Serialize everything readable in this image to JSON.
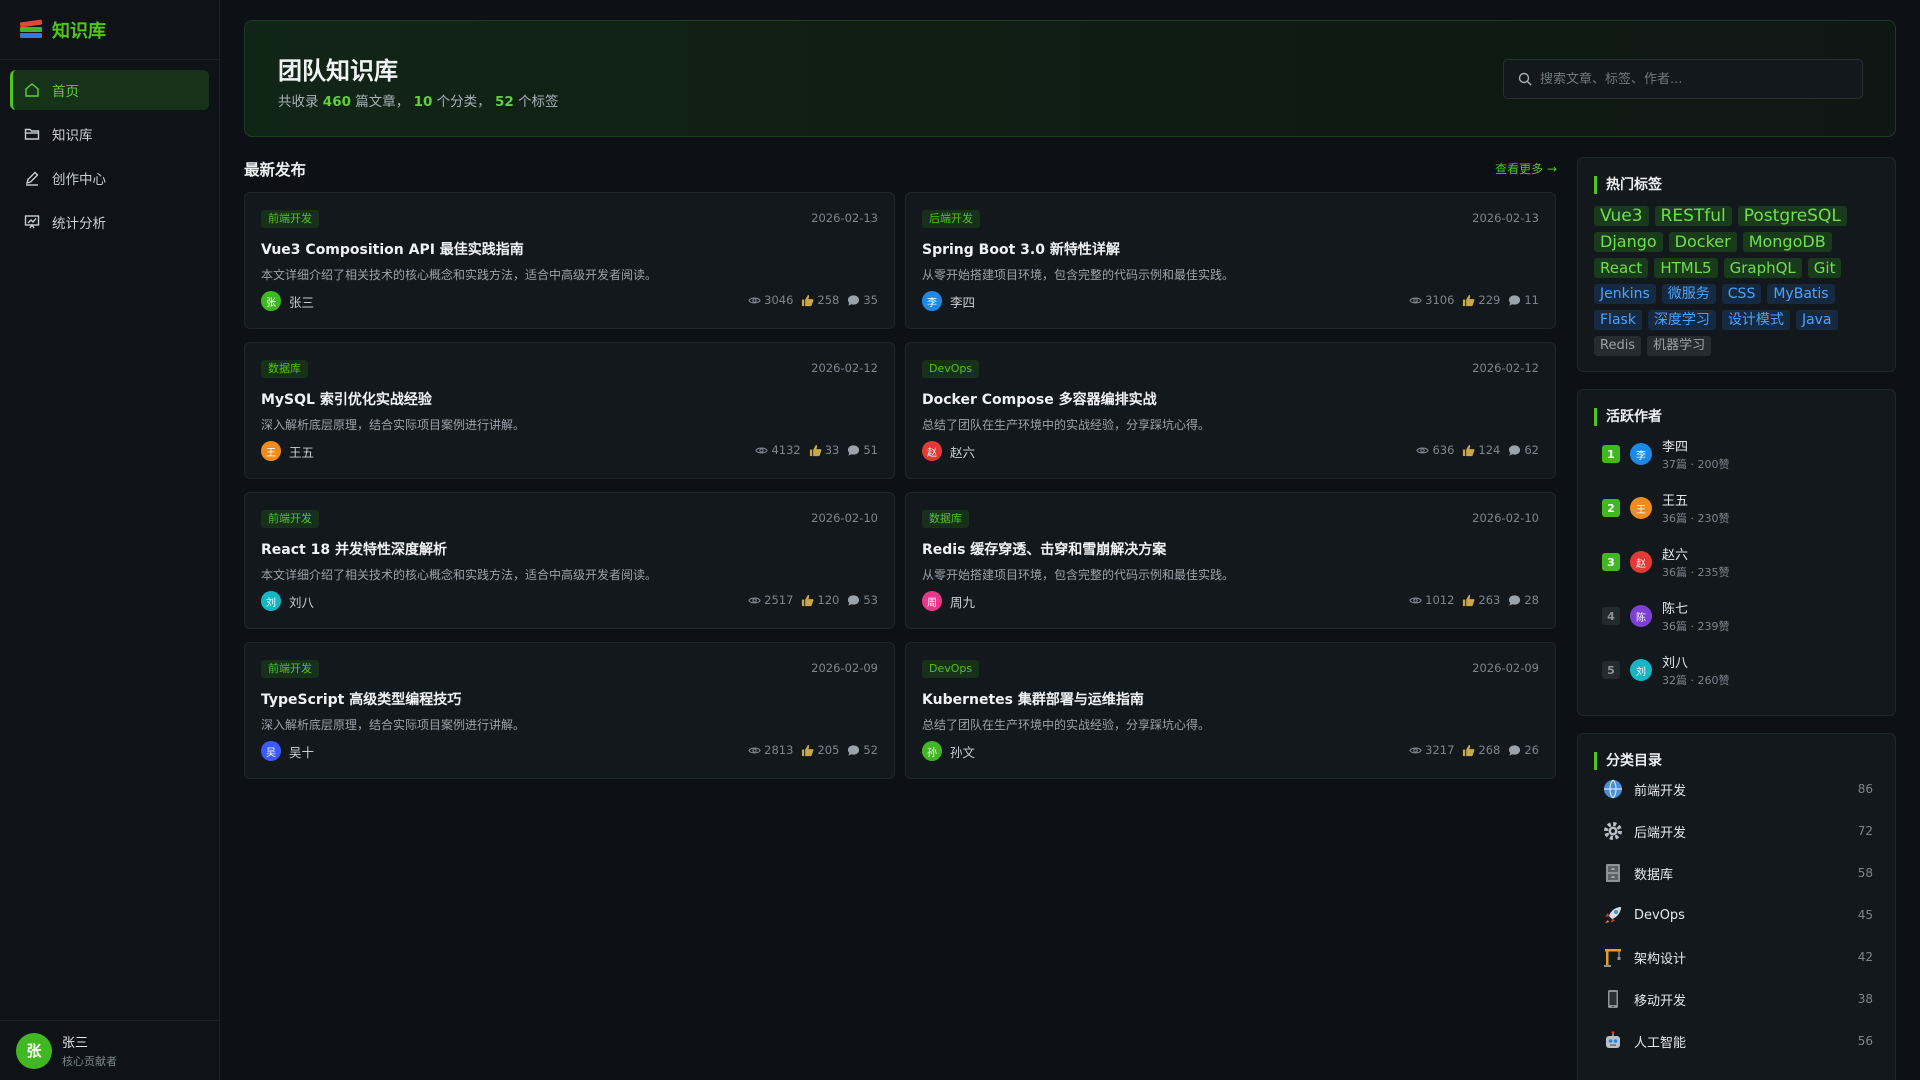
{
  "sidebar": {
    "brand": "知识库",
    "nav": [
      {
        "label": "首页",
        "icon": "home-icon",
        "active": true
      },
      {
        "label": "知识库",
        "icon": "folder-icon",
        "active": false
      },
      {
        "label": "创作中心",
        "icon": "pen-icon",
        "active": false
      },
      {
        "label": "统计分析",
        "icon": "chart-icon",
        "active": false
      }
    ],
    "user": {
      "avatar": "张",
      "name": "张三",
      "role": "核心贡献者"
    }
  },
  "hero": {
    "title": "团队知识库",
    "sub_prefix": "共收录",
    "articles": "460",
    "articles_unit": "篇文章，",
    "categories": "10",
    "categories_unit": "个分类，",
    "tags": "52",
    "tags_unit": "个标签",
    "search_placeholder": "搜索文章、标签、作者..."
  },
  "latest": {
    "title": "最新发布",
    "view_more": "查看更多 →",
    "cards": [
      {
        "tag": "前端开发",
        "date": "2026-02-13",
        "title": "Vue3 Composition API 最佳实践指南",
        "desc": "本文详细介绍了相关技术的核心概念和实践方法，适合中高级开发者阅读。",
        "author": "张三",
        "avatar": "张",
        "avatar_color": "#3fb822",
        "views": "3046",
        "likes": "258",
        "comments": "35"
      },
      {
        "tag": "后端开发",
        "date": "2026-02-13",
        "title": "Spring Boot 3.0 新特性详解",
        "desc": "从零开始搭建项目环境，包含完整的代码示例和最佳实践。",
        "author": "李四",
        "avatar": "李",
        "avatar_color": "#1e88e5",
        "views": "3106",
        "likes": "229",
        "comments": "11"
      },
      {
        "tag": "数据库",
        "date": "2026-02-12",
        "title": "MySQL 索引优化实战经验",
        "desc": "深入解析底层原理，结合实际项目案例进行讲解。",
        "author": "王五",
        "avatar": "王",
        "avatar_color": "#f08c1e",
        "views": "4132",
        "likes": "33",
        "comments": "51"
      },
      {
        "tag": "DevOps",
        "date": "2026-02-12",
        "title": "Docker Compose 多容器编排实战",
        "desc": "总结了团队在生产环境中的实战经验，分享踩坑心得。",
        "author": "赵六",
        "avatar": "赵",
        "avatar_color": "#e53935",
        "views": "636",
        "likes": "124",
        "comments": "62"
      },
      {
        "tag": "前端开发",
        "date": "2026-02-10",
        "title": "React 18 并发特性深度解析",
        "desc": "本文详细介绍了相关技术的核心概念和实践方法，适合中高级开发者阅读。",
        "author": "刘八",
        "avatar": "刘",
        "avatar_color": "#13b8c4",
        "views": "2517",
        "likes": "120",
        "comments": "53"
      },
      {
        "tag": "数据库",
        "date": "2026-02-10",
        "title": "Redis 缓存穿透、击穿和雪崩解决方案",
        "desc": "从零开始搭建项目环境，包含完整的代码示例和最佳实践。",
        "author": "周九",
        "avatar": "周",
        "avatar_color": "#e8388a",
        "views": "1012",
        "likes": "263",
        "comments": "28"
      },
      {
        "tag": "前端开发",
        "date": "2026-02-09",
        "title": "TypeScript 高级类型编程技巧",
        "desc": "深入解析底层原理，结合实际项目案例进行讲解。",
        "author": "吴十",
        "avatar": "吴",
        "avatar_color": "#3d5afe",
        "views": "2813",
        "likes": "205",
        "comments": "52"
      },
      {
        "tag": "DevOps",
        "date": "2026-02-09",
        "title": "Kubernetes 集群部署与运维指南",
        "desc": "总结了团队在生产环境中的实战经验，分享踩坑心得。",
        "author": "孙文",
        "avatar": "孙",
        "avatar_color": "#3fb822",
        "views": "3217",
        "likes": "268",
        "comments": "26"
      }
    ]
  },
  "hot_tags": {
    "title": "热门标签",
    "items": [
      {
        "label": "Vue3",
        "size": "xl",
        "color": "green"
      },
      {
        "label": "RESTful",
        "size": "xl",
        "color": "green"
      },
      {
        "label": "PostgreSQL",
        "size": "xl",
        "color": "green"
      },
      {
        "label": "Django",
        "size": "lg",
        "color": "green"
      },
      {
        "label": "Docker",
        "size": "lg",
        "color": "green"
      },
      {
        "label": "MongoDB",
        "size": "lg",
        "color": "green"
      },
      {
        "label": "React",
        "size": "md",
        "color": "green"
      },
      {
        "label": "HTML5",
        "size": "md",
        "color": "green"
      },
      {
        "label": "GraphQL",
        "size": "md",
        "color": "green"
      },
      {
        "label": "Git",
        "size": "md",
        "color": "green"
      },
      {
        "label": "Jenkins",
        "size": "sm",
        "color": "blue"
      },
      {
        "label": "微服务",
        "size": "sm",
        "color": "blue"
      },
      {
        "label": "CSS",
        "size": "sm",
        "color": "blue"
      },
      {
        "label": "MyBatis",
        "size": "sm",
        "color": "blue"
      },
      {
        "label": "Flask",
        "size": "sm",
        "color": "blue"
      },
      {
        "label": "深度学习",
        "size": "sm",
        "color": "blue"
      },
      {
        "label": "设计模式",
        "size": "sm",
        "color": "blue"
      },
      {
        "label": "Java",
        "size": "sm",
        "color": "blue"
      },
      {
        "label": "Redis",
        "size": "xs",
        "color": "gray"
      },
      {
        "label": "机器学习",
        "size": "xs",
        "color": "gray"
      }
    ]
  },
  "active_authors": {
    "title": "活跃作者",
    "items": [
      {
        "rank": "1",
        "avatar": "李",
        "avatar_color": "#1e88e5",
        "name": "李四",
        "meta": "37篇 · 200赞",
        "top": true
      },
      {
        "rank": "2",
        "avatar": "王",
        "avatar_color": "#f08c1e",
        "name": "王五",
        "meta": "36篇 · 230赞",
        "top": true
      },
      {
        "rank": "3",
        "avatar": "赵",
        "avatar_color": "#e53935",
        "name": "赵六",
        "meta": "36篇 · 235赞",
        "top": true
      },
      {
        "rank": "4",
        "avatar": "陈",
        "avatar_color": "#7e3fd6",
        "name": "陈七",
        "meta": "36篇 · 239赞",
        "top": false
      },
      {
        "rank": "5",
        "avatar": "刘",
        "avatar_color": "#13b8c4",
        "name": "刘八",
        "meta": "32篇 · 260赞",
        "top": false
      }
    ]
  },
  "categories": {
    "title": "分类目录",
    "items": [
      {
        "icon": "globe-icon",
        "name": "前端开发",
        "count": "86"
      },
      {
        "icon": "gear-icon",
        "name": "后端开发",
        "count": "72"
      },
      {
        "icon": "cabinet-icon",
        "name": "数据库",
        "count": "58"
      },
      {
        "icon": "rocket-icon",
        "name": "DevOps",
        "count": "45"
      },
      {
        "icon": "crane-icon",
        "name": "架构设计",
        "count": "42"
      },
      {
        "icon": "phone-icon",
        "name": "移动开发",
        "count": "38"
      },
      {
        "icon": "robot-icon",
        "name": "人工智能",
        "count": "56"
      }
    ]
  }
}
